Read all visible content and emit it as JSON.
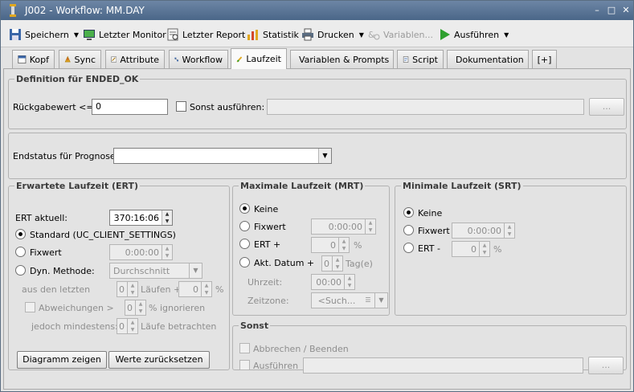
{
  "window": {
    "title": "J002 - Workflow: MM.DAY",
    "min": "–",
    "max": "□",
    "close": "✕"
  },
  "toolbar": {
    "save": "Speichern",
    "monitor": "Letzter Monitor",
    "report": "Letzter Report",
    "stats": "Statistik",
    "print": "Drucken",
    "variables": "Variablen...",
    "execute": "Ausführen"
  },
  "tabs": [
    "Kopf",
    "Sync",
    "Attribute",
    "Workflow",
    "Laufzeit",
    "Variablen & Prompts",
    "Script",
    "Dokumentation",
    "[+]"
  ],
  "ended_ok": {
    "title": "Definition für ENDED_OK",
    "return_label": "Rückgabewert <=:",
    "return_value": "0",
    "else_label": "Sonst ausführen:",
    "else_value": "",
    "browse": "..."
  },
  "prognose": {
    "label": "Endstatus für Prognose:",
    "value": ""
  },
  "ert": {
    "title": "Erwartete Laufzeit (ERT)",
    "current_label": "ERT aktuell:",
    "current_value": "370:16:06",
    "standard": "Standard (UC_CLIENT_SETTINGS)",
    "fixed": "Fixwert",
    "fixed_value": "0:00:00",
    "dyn": "Dyn. Methode:",
    "dyn_value": "Durchschnitt",
    "last_label": "aus den letzten",
    "last_value": "0",
    "runs_label": "Läufen +",
    "runs_value": "0",
    "percent": "%",
    "dev_label": "Abweichungen >",
    "dev_value": "0",
    "ignore_label": "% ignorieren",
    "min_label": "jedoch mindestens:",
    "min_value": "0",
    "consider_label": "Läufe betrachten",
    "chart_button": "Diagramm zeigen",
    "reset_button": "Werte zurücksetzen"
  },
  "mrt": {
    "title": "Maximale Laufzeit (MRT)",
    "none": "Keine",
    "fixed": "Fixwert",
    "fixed_value": "0:00:00",
    "ert_plus": "ERT +",
    "ert_value": "0",
    "percent": "%",
    "date": "Akt. Datum +",
    "date_value": "0",
    "days": "Tag(e)",
    "time_label": "Uhrzeit:",
    "time_value": "00:00",
    "zone_label": "Zeitzone:",
    "zone_value": "<Such..."
  },
  "srt": {
    "title": "Minimale Laufzeit (SRT)",
    "none": "Keine",
    "fixed": "Fixwert",
    "fixed_value": "0:00:00",
    "ert_minus": "ERT -",
    "ert_value": "0",
    "percent": "%"
  },
  "sonst": {
    "title": "Sonst",
    "abort": "Abbrechen / Beenden",
    "execute": "Ausführen",
    "execute_value": "",
    "browse": "..."
  }
}
